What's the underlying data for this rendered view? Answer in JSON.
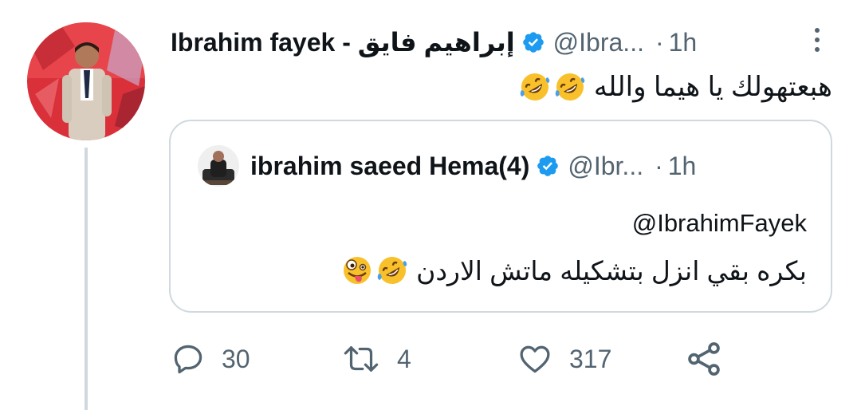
{
  "tweet": {
    "author_name": "Ibrahim fayek - إبراهيم فايق",
    "handle": "@Ibra...",
    "separator": "·",
    "time": "1h",
    "text": "هبعتهولك يا هيما والله",
    "text_emojis": [
      "rolling-on-floor-laughing",
      "rolling-on-floor-laughing"
    ]
  },
  "quote": {
    "author_name": "ibrahim saeed Hema(4)",
    "handle": "@Ibr...",
    "separator": "·",
    "time": "1h",
    "mention": "@IbrahimFayek",
    "text": "بكره بقي انزل بتشكيله ماتش الاردن",
    "text_emojis": [
      "rolling-on-floor-laughing",
      "zany-face"
    ]
  },
  "actions": {
    "replies": "30",
    "retweets": "4",
    "likes": "317"
  },
  "colors": {
    "text_primary": "#0f1419",
    "text_secondary": "#536471",
    "verified_blue": "#1d9bf0",
    "border": "#cfd9de"
  },
  "icons": [
    "verified-badge-icon",
    "more-icon",
    "reply-icon",
    "retweet-icon",
    "like-icon",
    "share-icon"
  ]
}
